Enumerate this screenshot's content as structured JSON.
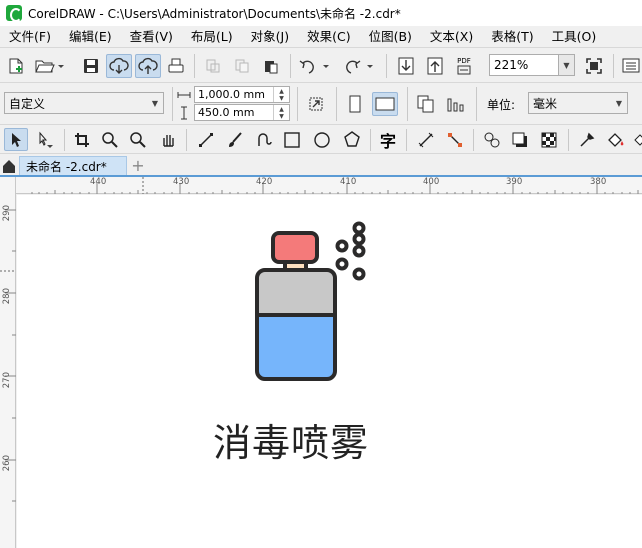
{
  "window": {
    "title": "CorelDRAW - C:\\Users\\Administrator\\Documents\\未命名 -2.cdr*"
  },
  "menu": [
    "文件(F)",
    "编辑(E)",
    "查看(V)",
    "布局(L)",
    "对象(J)",
    "效果(C)",
    "位图(B)",
    "文本(X)",
    "表格(T)",
    "工具(O)"
  ],
  "toolbar": {
    "zoom_value": "221%",
    "pdf_label": "PDF"
  },
  "property_bar": {
    "page_preset": "自定义",
    "width": "1,000.0 mm",
    "height": "450.0 mm",
    "units_label": "单位:",
    "units_value": "毫米"
  },
  "toolbox": {
    "text_tool_glyph": "字"
  },
  "document_tab": {
    "label": "未命名 -2.cdr*",
    "add_symbol": "+"
  },
  "ruler": {
    "h_ticks": [
      "440",
      "430",
      "420",
      "410",
      "400",
      "390",
      "380"
    ],
    "v_ticks": [
      "290",
      "280",
      "270",
      "260"
    ]
  },
  "artwork": {
    "caption": "消毒喷雾",
    "colors": {
      "cap": "#f47a7a",
      "neck": "#fde0c0",
      "body_top": "#c8c8c8",
      "liquid": "#76b5fb",
      "outline": "#2b2a2a"
    }
  }
}
